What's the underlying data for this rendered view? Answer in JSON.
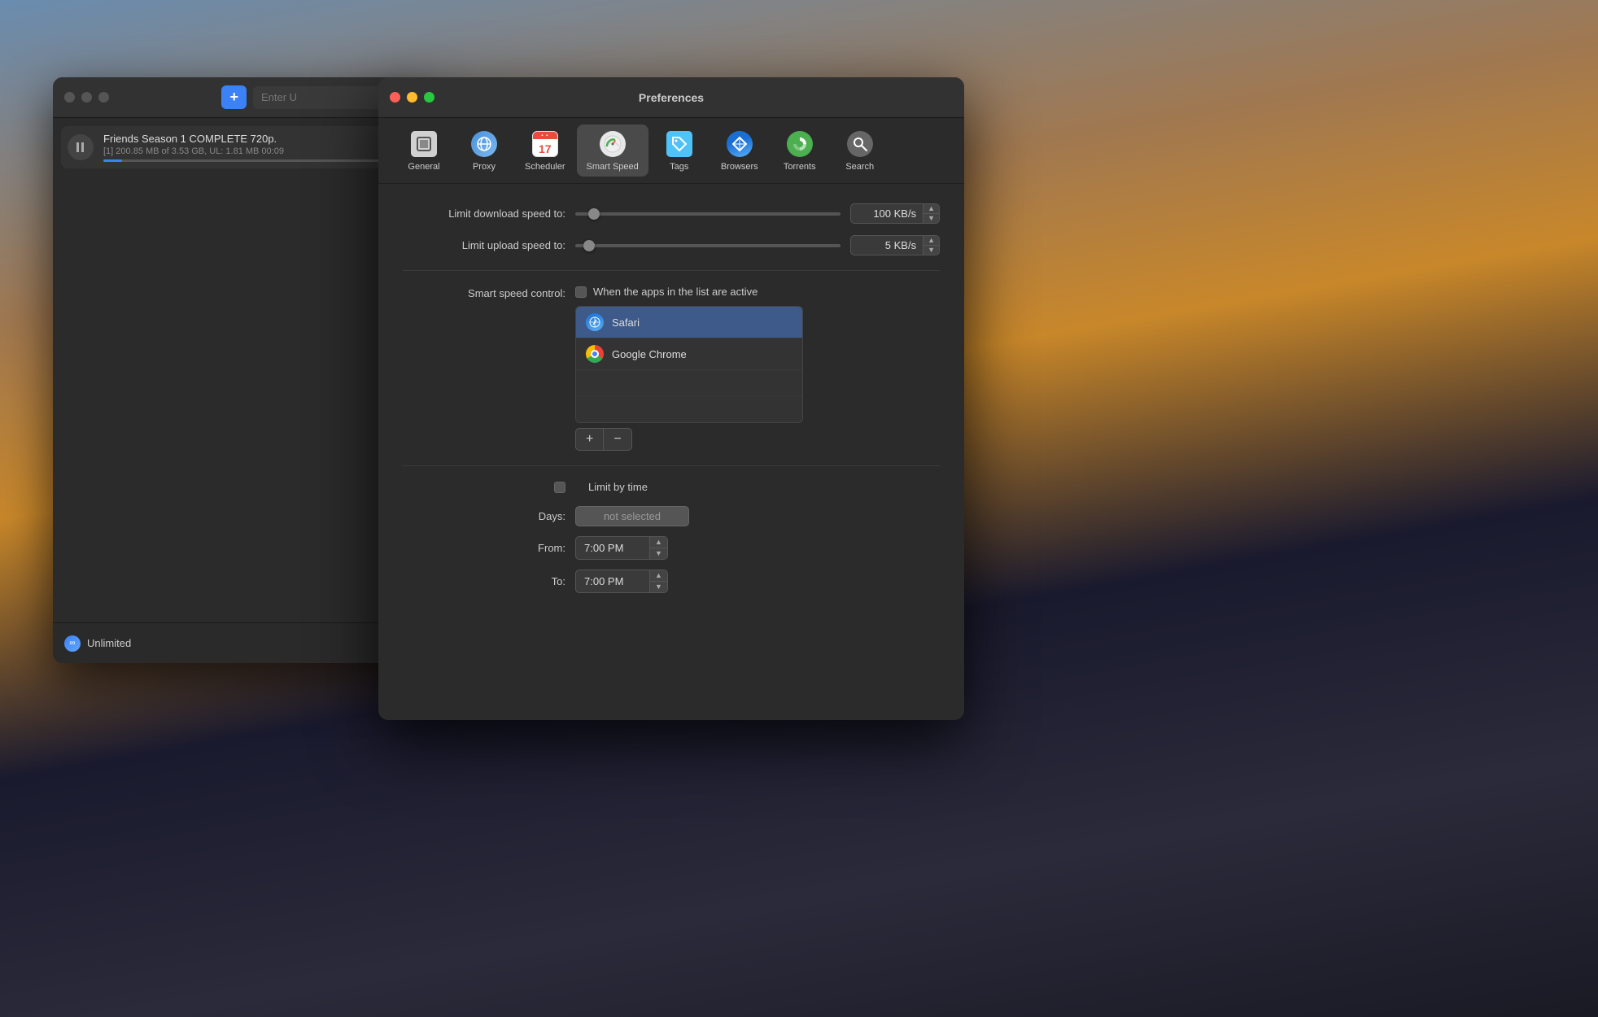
{
  "background": {
    "type": "city-sky"
  },
  "download_manager": {
    "title": "",
    "add_button": "+",
    "search_placeholder": "Enter U",
    "item": {
      "name": "Friends Season 1 COMPLETE 720p.",
      "detail": "[1] 200.85 MB of 3.53 GB, UL: 1.81 MB 00:09",
      "progress_percent": 6
    },
    "footer": {
      "icon": "∞",
      "label": "Unlimited"
    }
  },
  "preferences": {
    "title": "Preferences",
    "toolbar": {
      "items": [
        {
          "id": "general",
          "label": "General",
          "icon": "general"
        },
        {
          "id": "proxy",
          "label": "Proxy",
          "icon": "proxy"
        },
        {
          "id": "scheduler",
          "label": "Scheduler",
          "icon": "scheduler"
        },
        {
          "id": "smart-speed",
          "label": "Smart Speed",
          "icon": "smart-speed",
          "active": true
        },
        {
          "id": "tags",
          "label": "Tags",
          "icon": "tags"
        },
        {
          "id": "browsers",
          "label": "Browsers",
          "icon": "browsers"
        },
        {
          "id": "torrents",
          "label": "Torrents",
          "icon": "torrents"
        },
        {
          "id": "search",
          "label": "Search",
          "icon": "search"
        }
      ]
    },
    "smart_speed": {
      "download_label": "Limit download speed to:",
      "download_value": "100 KB/s",
      "upload_label": "Limit upload speed to:",
      "upload_value": "5 KB/s",
      "smart_speed_label": "Smart speed control:",
      "checkbox_label": "When the apps in the list are active",
      "checkbox_checked": false,
      "apps": [
        {
          "name": "Safari",
          "icon": "safari"
        },
        {
          "name": "Google Chrome",
          "icon": "chrome"
        }
      ],
      "add_button": "+",
      "remove_button": "−",
      "limit_time_checkbox_checked": false,
      "limit_time_label": "Limit by time",
      "days_label": "Days:",
      "days_value": "not selected",
      "from_label": "From:",
      "from_value": "7:00 PM",
      "to_label": "To:",
      "to_value": "7:00 PM"
    }
  }
}
